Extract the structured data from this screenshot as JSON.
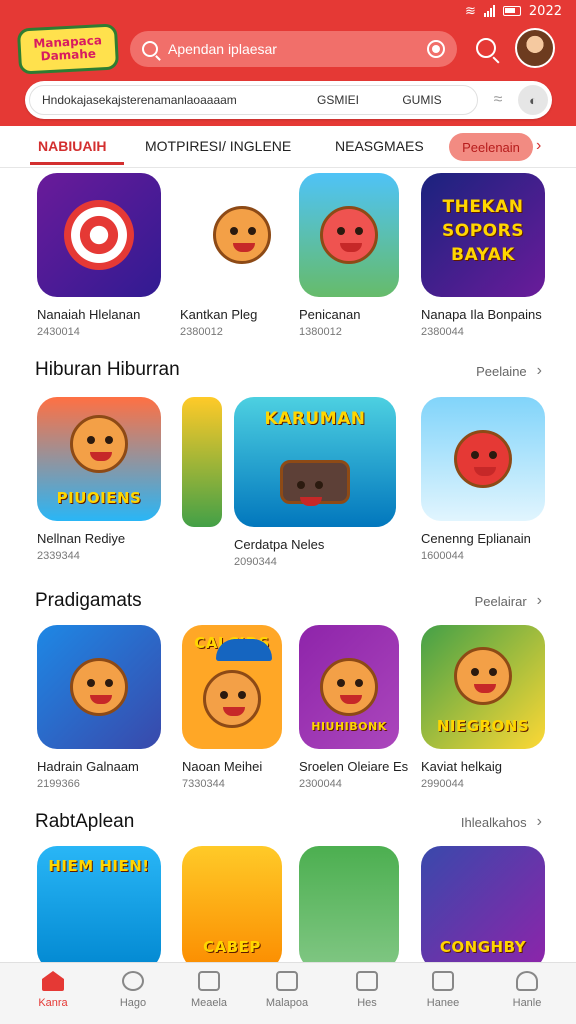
{
  "status_bar": {
    "time": "2022"
  },
  "header": {
    "logo_text": "Manapaca Damahe",
    "search_placeholder": "Apendan iplaesar"
  },
  "filter_bar": {
    "query": "Hndokajasekajsterenamanlaoaaaam",
    "chip_1": "GSMIEI",
    "chip_2": "GUMIS"
  },
  "tabs": [
    {
      "label": "NABIUAIH"
    },
    {
      "label": "MOTPIRESI/ INGLENE"
    },
    {
      "label": "NEASGMAES"
    },
    {
      "label": "Peelenain"
    }
  ],
  "rows": [
    {
      "title": "",
      "more": "",
      "apps": [
        {
          "name": "Nanaiah Hlelanan",
          "meta": "2430014"
        },
        {
          "name": "Kantkan Pleg",
          "meta": "2380012"
        },
        {
          "name": "Penicanan",
          "meta": "1380012"
        },
        {
          "name": "Nanapa Ila Bonpains",
          "meta": "2380044",
          "banner": "THEKAN SOPORS BAYAK"
        }
      ]
    },
    {
      "title": "Hiburan Hiburran",
      "more": "Peelaine",
      "apps": [
        {
          "name": "Nellnan Rediye",
          "meta": "2339344",
          "banner": "PIUOIENS"
        },
        {
          "name": "",
          "meta": ""
        },
        {
          "name": "Cerdatpa Neles",
          "meta": "2090344",
          "banner": "KARUMAN"
        },
        {
          "name": "Cenenng Eplianain",
          "meta": "1600044"
        }
      ]
    },
    {
      "title": "Pradigamats",
      "more": "Peelairar",
      "apps": [
        {
          "name": "Hadrain Galnaam",
          "meta": "2199366"
        },
        {
          "name": "Naoan Meihei",
          "meta": "7330344",
          "banner": "CALCIDS"
        },
        {
          "name": "Sroelen Oleiare Es",
          "meta": "2300044",
          "banner": "HIUHIBONK"
        },
        {
          "name": "Kaviat helkaig",
          "meta": "2990044",
          "banner": "NIEGRONS"
        }
      ]
    },
    {
      "title": "RabtAplean",
      "more": "Ihlealkahos",
      "apps": [
        {
          "name": "",
          "meta": "",
          "banner": "HIEM HIEN!"
        },
        {
          "name": "",
          "meta": "",
          "banner": "CABEP"
        },
        {
          "name": "",
          "meta": "",
          "banner": ""
        },
        {
          "name": "",
          "meta": "",
          "banner": "CONGHBY"
        }
      ]
    }
  ],
  "nav": [
    {
      "label": "Kanra"
    },
    {
      "label": "Hago"
    },
    {
      "label": "Meaela"
    },
    {
      "label": "Malapoa"
    },
    {
      "label": "Hes"
    },
    {
      "label": "Hanee"
    },
    {
      "label": "Hanle"
    }
  ],
  "colors": {
    "primary": "#e53935",
    "accent": "#d32f2f"
  }
}
